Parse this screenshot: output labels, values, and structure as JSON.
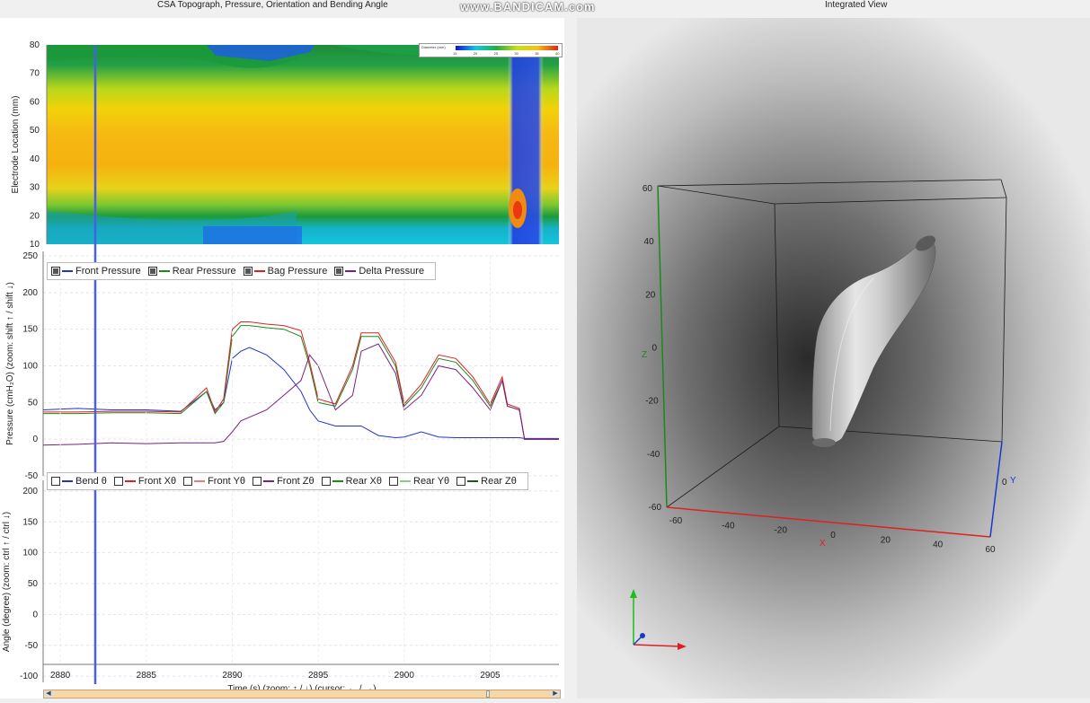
{
  "window": {
    "left_title": "CSA Topograph, Pressure, Orientation and Bending Angle",
    "right_title": "Integrated View",
    "watermark": "www.BANDICAM.com"
  },
  "colors": {
    "front_pressure": "#2233cc",
    "rear_pressure": "#1a8a1a",
    "bag_pressure": "#e02020",
    "delta_pressure": "#7a2080",
    "cursor_line": "#4a5ee8",
    "x_axis": "#e02020",
    "y_axis": "#1a3acc",
    "z_axis": "#1a8a1a"
  },
  "colorbar": {
    "label": "Diameter (mm)",
    "ticks": [
      "15",
      "20",
      "25",
      "30",
      "35",
      "40"
    ]
  },
  "topograph": {
    "ylabel": "Electrode Location (mm)",
    "yticks": [
      "80",
      "70",
      "60",
      "50",
      "40",
      "30",
      "20",
      "10"
    ]
  },
  "pressure_chart": {
    "ylabel": "Pressure (cmH₂O) (zoom: shift ↑ / shift ↓)",
    "yticks": [
      "250",
      "200",
      "150",
      "100",
      "50",
      "0",
      "-50"
    ],
    "legend": [
      {
        "label": "Front Pressure",
        "checked": true
      },
      {
        "label": "Rear Pressure",
        "checked": true
      },
      {
        "label": "Bag Pressure",
        "checked": true
      },
      {
        "label": "Delta Pressure",
        "checked": true
      }
    ]
  },
  "angle_chart": {
    "ylabel": "Angle (degree) (zoom: ctrl ↑ / ctrl ↓)",
    "yticks": [
      "200",
      "150",
      "100",
      "50",
      "0",
      "-50",
      "-100"
    ],
    "legend": [
      {
        "label": "Bend θ",
        "checked": false
      },
      {
        "label": "Front Xθ",
        "checked": false
      },
      {
        "label": "Front Yθ",
        "checked": false
      },
      {
        "label": "Front Zθ",
        "checked": false
      },
      {
        "label": "Rear Xθ",
        "checked": false
      },
      {
        "label": "Rear Yθ",
        "checked": false
      },
      {
        "label": "Rear Zθ",
        "checked": false
      }
    ]
  },
  "time_axis": {
    "label": "Time (s) (zoom: ↑ / ↓) (cursor: ← / →)",
    "ticks": [
      "2880",
      "2885",
      "2890",
      "2895",
      "2900",
      "2905"
    ]
  },
  "view3d": {
    "z_label": "Z",
    "x_label": "X",
    "y_label": "Y",
    "z_ticks": [
      "60",
      "40",
      "20",
      "0",
      "-20",
      "-40",
      "-60"
    ],
    "x_ticks": [
      "-60",
      "-40",
      "-20",
      "0",
      "20",
      "40",
      "60"
    ],
    "y_tick": "0"
  },
  "chart_data": [
    {
      "type": "line",
      "title": "",
      "xlabel": "Time (s) (zoom: ↑ / ↓) (cursor: ← / →)",
      "ylabel": "Pressure (cmH₂O) (zoom: shift ↑ / shift ↓)",
      "xlim": [
        2879,
        2909
      ],
      "ylim": [
        -50,
        250
      ],
      "grid": true,
      "legend": "top-left",
      "x": [
        2879,
        2881,
        2883,
        2885,
        2887,
        2888.5,
        2889,
        2889.5,
        2890,
        2890.5,
        2891,
        2892,
        2893,
        2894,
        2894.5,
        2895,
        2896,
        2897,
        2897.5,
        2898.5,
        2899.5,
        2900,
        2901,
        2902,
        2903,
        2904,
        2905,
        2905.7,
        2906,
        2906.7,
        2907,
        2909
      ],
      "series": [
        {
          "name": "Front Pressure",
          "values": [
            40,
            42,
            40,
            40,
            38,
            65,
            40,
            50,
            110,
            120,
            125,
            115,
            95,
            65,
            40,
            25,
            18,
            18,
            18,
            5,
            2,
            3,
            10,
            3,
            2,
            2,
            2,
            2,
            2,
            2,
            1,
            1
          ]
        },
        {
          "name": "Rear Pressure",
          "values": [
            35,
            35,
            36,
            36,
            35,
            65,
            35,
            50,
            140,
            155,
            155,
            152,
            150,
            140,
            100,
            50,
            45,
            95,
            140,
            140,
            100,
            45,
            70,
            110,
            105,
            80,
            45,
            80,
            45,
            40,
            0,
            0
          ]
        },
        {
          "name": "Bag Pressure",
          "values": [
            37,
            37,
            38,
            38,
            37,
            70,
            37,
            55,
            150,
            160,
            160,
            157,
            155,
            148,
            105,
            55,
            48,
            100,
            145,
            145,
            105,
            48,
            75,
            115,
            110,
            85,
            48,
            85,
            48,
            42,
            0,
            0
          ]
        },
        {
          "name": "Delta Pressure",
          "values": [
            -8,
            -7,
            -5,
            -6,
            -5,
            -5,
            -5,
            -3,
            10,
            25,
            30,
            40,
            60,
            80,
            115,
            100,
            40,
            60,
            120,
            130,
            90,
            40,
            60,
            100,
            95,
            70,
            40,
            80,
            45,
            40,
            0,
            0
          ]
        }
      ]
    },
    {
      "type": "line",
      "title": "",
      "xlabel": "Time (s) (zoom: ↑ / ↓) (cursor: ← / →)",
      "ylabel": "Angle (degree) (zoom: ctrl ↑ / ctrl ↓)",
      "xlim": [
        2879,
        2909
      ],
      "ylim": [
        -110,
        210
      ],
      "grid": true,
      "legend": "top-left",
      "series": []
    }
  ]
}
